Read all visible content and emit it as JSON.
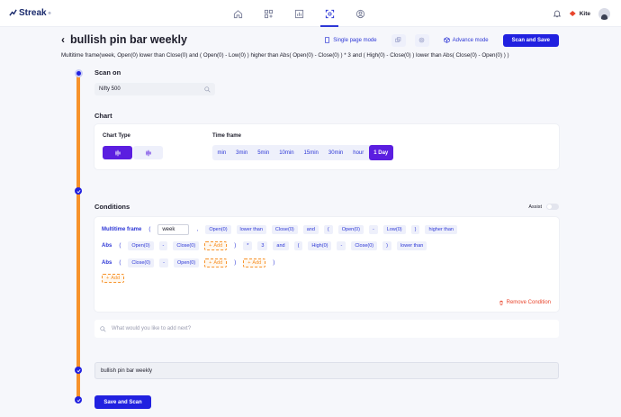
{
  "app": {
    "name": "Streak",
    "trademark": "®"
  },
  "nav": [
    "home-icon",
    "dashboard-icon",
    "chart-icon",
    "scan-icon",
    "profile-icon"
  ],
  "topright": {
    "broker": "Kite"
  },
  "scan": {
    "title": "bullish pin bar weekly",
    "single_page_label": "Single page mode",
    "advance_label": "Advance mode",
    "scan_and_save_label": "Scan and Save",
    "condition_text": "Multitime frame(week, Open(0) lower than Close(0) and ( Open(0) - Low(0) ) higher than Abs( Open(0) - Close(0) ) * 3 and ( High(0) - Close(0) ) lower than Abs( Close(0) - Open(0) ) )"
  },
  "scan_on": {
    "heading": "Scan on",
    "value": "Nifty 500"
  },
  "chart": {
    "heading": "Chart",
    "chart_type_label": "Chart Type",
    "timeframe_label": "Time frame",
    "timeframes": [
      "min",
      "3min",
      "5min",
      "10min",
      "15min",
      "30min",
      "hour",
      "1 Day"
    ],
    "selected_timeframe": "1 Day"
  },
  "conditions": {
    "heading": "Conditions",
    "assist_label": "Assist",
    "row1": {
      "fn": "Multitime frame",
      "p1": "(",
      "input": "week",
      "comma": ",",
      "t1": "Open(0)",
      "t2": "lower than",
      "t3": "Close(0)",
      "t4": "and",
      "t5": "(",
      "t6": "Open(0)",
      "t7": "-",
      "t8": "Low(0)",
      "t9": ")",
      "t10": "higher than"
    },
    "row2": {
      "fn": "Abs",
      "p1": "(",
      "t1": "Open(0)",
      "t2": "-",
      "t3": "Close(0)",
      "add": "Add",
      "p2": ")",
      "t4": "*",
      "t5": "3",
      "t6": "and",
      "t7": "(",
      "t8": "High(0)",
      "t9": "-",
      "t10": "Close(0)",
      "t11": ")",
      "t12": "lower than"
    },
    "row3": {
      "fn": "Abs",
      "p1": "(",
      "t1": "Close(0)",
      "t2": "-",
      "t3": "Open(0)",
      "add": "Add",
      "p2": ")",
      "add2": "Add",
      "p3": ")"
    },
    "row4": {
      "add": "Add"
    },
    "remove_label": "Remove Condition",
    "next_placeholder": "What would you like to add next?"
  },
  "footer": {
    "scan_name": "bullish pin bar weekly",
    "save_scan_label": "Save and Scan"
  },
  "colors": {
    "primary": "#2121e0",
    "accent": "#f7932b",
    "danger": "#e8452c"
  }
}
